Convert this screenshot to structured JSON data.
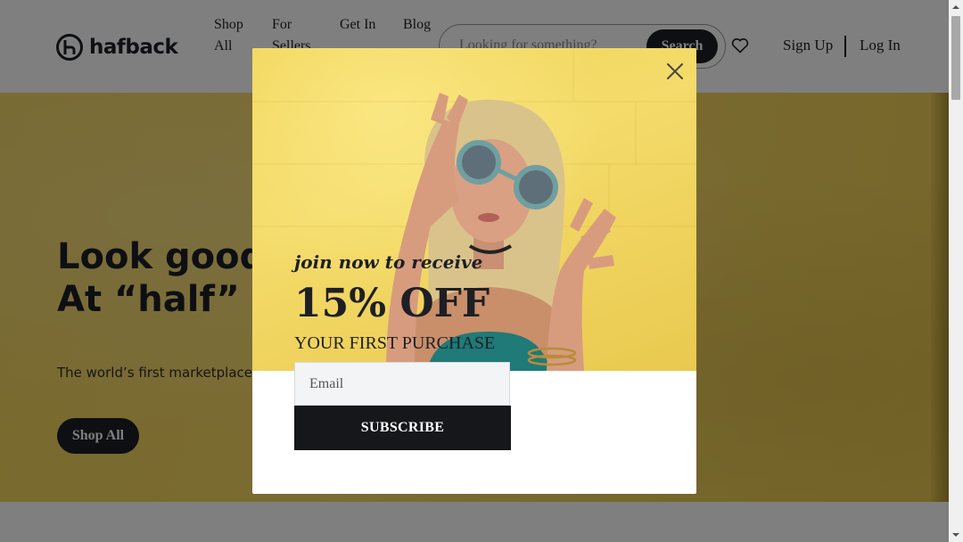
{
  "header": {
    "logo_text": "hafback",
    "nav": [
      {
        "label": "Shop All"
      },
      {
        "label": "For Sellers"
      },
      {
        "label": "Get In"
      },
      {
        "label": "Blog"
      }
    ],
    "search": {
      "placeholder": "Looking for something?",
      "button_label": "Search"
    },
    "signup_label": "Sign Up",
    "login_label": "Log In"
  },
  "hero": {
    "headline": "Look good. Feel good. At “half” the price.",
    "subtext": "The world’s first marketplace for sustainability through returns.",
    "button_label": "Shop All"
  },
  "modal": {
    "lead": "join now to receive",
    "offer": "15% OFF",
    "sub": "YOUR FIRST PURCHASE",
    "email_placeholder": "Email",
    "subscribe_label": "SUBSCRIBE"
  },
  "colors": {
    "brand_dark": "#1d1f24",
    "hero_yellow": "#f4d963",
    "overlay": "rgba(0,0,0,0.5)"
  },
  "icons": [
    "hafback-logo-icon",
    "heart-icon",
    "close-icon",
    "scroll-up-arrow-icon",
    "scroll-down-arrow-icon"
  ]
}
